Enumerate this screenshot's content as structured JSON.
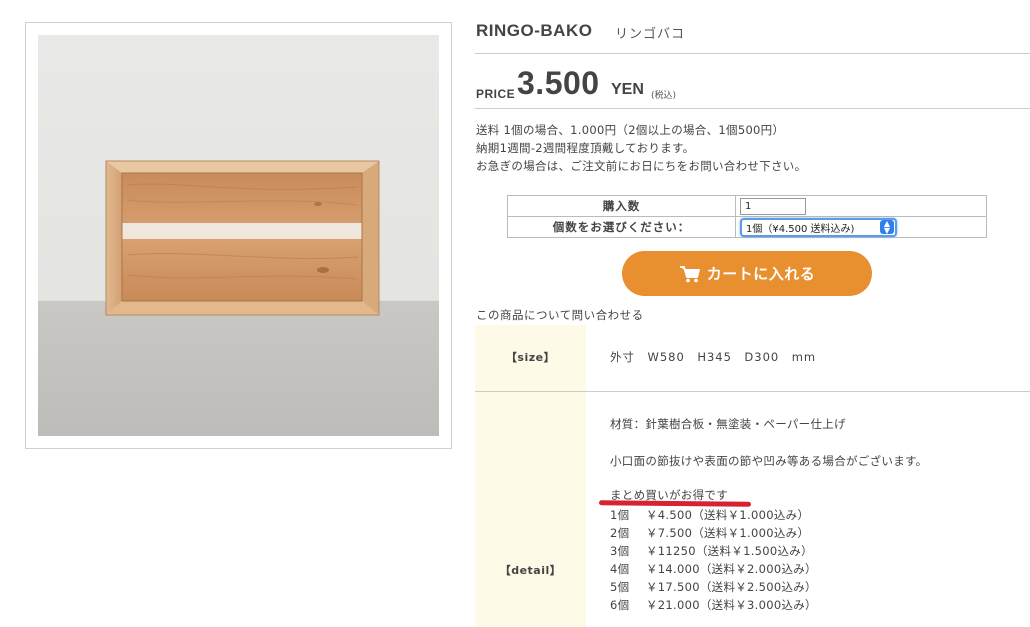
{
  "product": {
    "name_en": "RINGO-BAKO",
    "name_jp": "リンゴバコ",
    "image_alt": "wooden apple crate"
  },
  "price": {
    "label": "PRICE",
    "value": "3.500",
    "unit": "YEN",
    "tax_note": "(税込)"
  },
  "notes": [
    "送料 1個の場合、1.000円（2個以上の場合、1個500円）",
    "納期1週間-2週間程度頂戴しております。",
    "お急ぎの場合は、ご注文前にお日にちをお問い合わせ下さい。"
  ],
  "order_form": {
    "qty_label": "購入数",
    "qty_value": "1",
    "select_label": "個数をお選びください：",
    "select_value": "1個（¥4.500 送料込み)",
    "cart_button": "カートに入れる"
  },
  "inquiry_link": "この商品について問い合わせる",
  "spec": {
    "size_key": "【size】",
    "size_value": "外寸　W580　H345　D300　mm",
    "detail_key": "【detail】",
    "material": "材質：針葉樹合板・無塗装・ペーパー仕上げ",
    "note": "小口面の節抜けや表面の節や凹み等ある場合がございます。",
    "bulk_title": "まとめ買いがお得です",
    "bulk_prices": [
      {
        "qty": "1個",
        "price": "￥4.500（送料￥1.000込み）"
      },
      {
        "qty": "2個",
        "price": "￥7.500（送料￥1.000込み）"
      },
      {
        "qty": "3個",
        "price": "￥11250（送料￥1.500込み）"
      },
      {
        "qty": "4個",
        "price": "￥14.000（送料￥2.000込み）"
      },
      {
        "qty": "5個",
        "price": "￥17.500（送料￥2.500込み）"
      },
      {
        "qty": "6個",
        "price": "￥21.000（送料￥3.000込み）"
      }
    ]
  },
  "colors": {
    "cart_button": "#e88f2f",
    "label_column_bg": "#fdfbe7",
    "highlight_underline": "#d6232f",
    "select_focus": "#5b9ce8"
  }
}
